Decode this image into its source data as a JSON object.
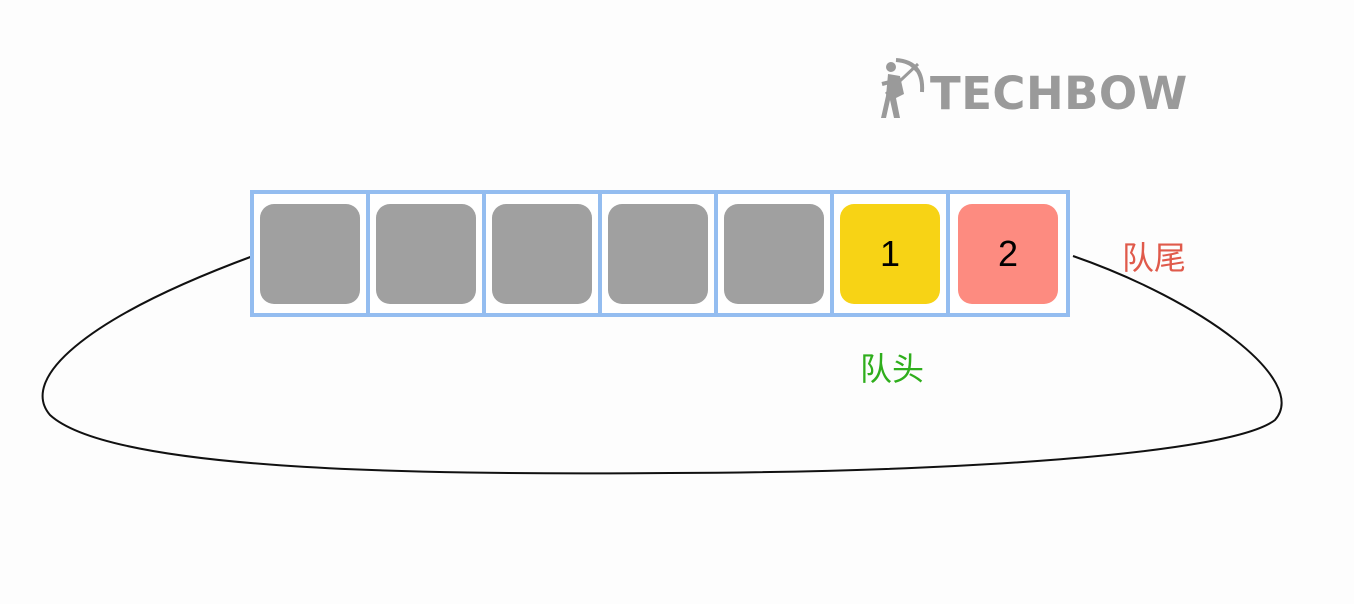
{
  "logo": {
    "text": "TECHBOW",
    "icon": "archer-icon",
    "color": "#9a9a9a"
  },
  "queue": {
    "cells": [
      {
        "value": "",
        "state": "empty",
        "color": "#a0a0a0"
      },
      {
        "value": "",
        "state": "empty",
        "color": "#a0a0a0"
      },
      {
        "value": "",
        "state": "empty",
        "color": "#a0a0a0"
      },
      {
        "value": "",
        "state": "empty",
        "color": "#a0a0a0"
      },
      {
        "value": "",
        "state": "empty",
        "color": "#a0a0a0"
      },
      {
        "value": "1",
        "state": "filled",
        "color": "#f7d315"
      },
      {
        "value": "2",
        "state": "filled",
        "color": "#fd8b80"
      }
    ],
    "border_color": "#94bdf0"
  },
  "labels": {
    "tail": "队尾",
    "tail_color": "#e05a4b",
    "head": "队头",
    "head_color": "#2fae1c"
  }
}
